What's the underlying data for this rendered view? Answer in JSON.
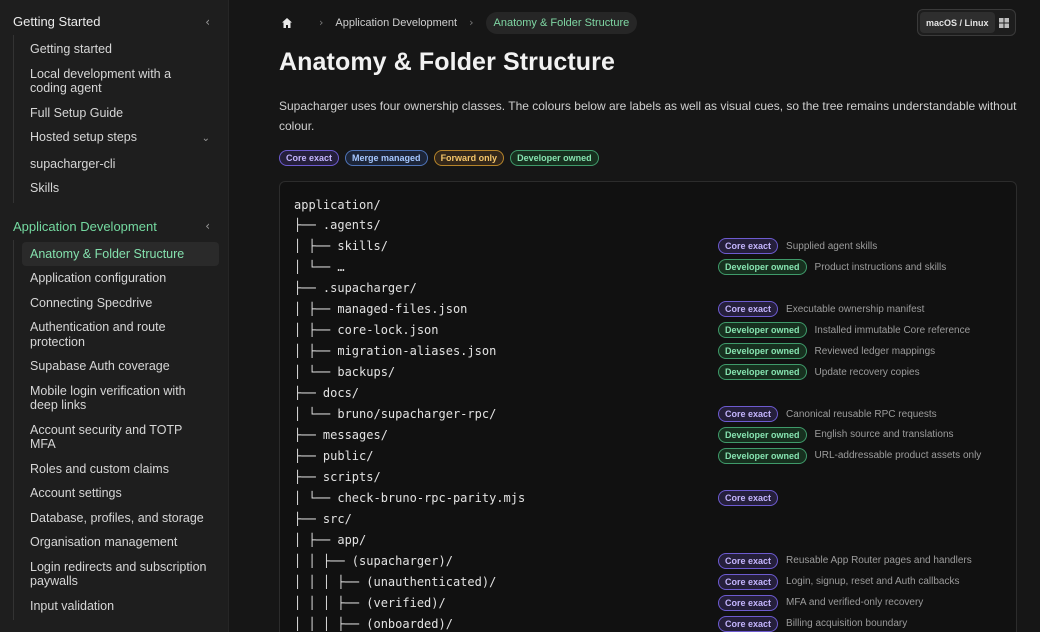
{
  "sidebar": {
    "sections": [
      {
        "title": "Getting Started",
        "active": false,
        "items": [
          {
            "label": "Getting started"
          },
          {
            "label": "Local development with a coding agent"
          },
          {
            "label": "Full Setup Guide"
          },
          {
            "label": "Hosted setup steps",
            "expandable": true
          },
          {
            "label": "supacharger-cli"
          },
          {
            "label": "Skills"
          }
        ]
      },
      {
        "title": "Application Development",
        "active": true,
        "items": [
          {
            "label": "Anatomy & Folder Structure",
            "current": true
          },
          {
            "label": "Application configuration"
          },
          {
            "label": "Connecting Specdrive"
          },
          {
            "label": "Authentication and route protection"
          },
          {
            "label": "Supabase Auth coverage"
          },
          {
            "label": "Mobile login verification with deep links"
          },
          {
            "label": "Account security and TOTP MFA"
          },
          {
            "label": "Roles and custom claims"
          },
          {
            "label": "Account settings"
          },
          {
            "label": "Database, profiles, and storage"
          },
          {
            "label": "Organisation management"
          },
          {
            "label": "Login redirects and subscription paywalls"
          },
          {
            "label": "Input validation"
          }
        ]
      }
    ]
  },
  "breadcrumb": {
    "home_icon": "home-icon",
    "items": [
      "Application Development"
    ],
    "current": "Anatomy & Folder Structure"
  },
  "os_switch": {
    "selected": "macOS / Linux",
    "other_icon": "windows-icon"
  },
  "page": {
    "title": "Anatomy & Folder Structure",
    "intro": "Supacharger uses four ownership classes. The colours below are labels as well as visual cues, so the tree remains understandable without colour."
  },
  "legend": [
    {
      "label": "Core exact",
      "kind": "core"
    },
    {
      "label": "Merge managed",
      "kind": "merge"
    },
    {
      "label": "Forward only",
      "kind": "fwd"
    },
    {
      "label": "Developer owned",
      "kind": "dev"
    }
  ],
  "colors": {
    "accent_green": "#74d9a0",
    "core": "#c4b5fd",
    "merge": "#a6c8ff",
    "forward": "#f5c66a",
    "developer": "#86e3b0"
  },
  "tree": [
    {
      "code": "application/",
      "badge": "",
      "kind": "",
      "desc": ""
    },
    {
      "code": "├── .agents/",
      "badge": "",
      "kind": "",
      "desc": ""
    },
    {
      "code": "│ ├── skills/",
      "badge": "Core exact",
      "kind": "core",
      "desc": "Supplied agent skills"
    },
    {
      "code": "│ └── …",
      "badge": "Developer owned",
      "kind": "dev",
      "desc": "Product instructions and skills"
    },
    {
      "code": "├── .supacharger/",
      "badge": "",
      "kind": "",
      "desc": ""
    },
    {
      "code": "│ ├── managed-files.json",
      "badge": "Core exact",
      "kind": "core",
      "desc": "Executable ownership manifest"
    },
    {
      "code": "│ ├── core-lock.json",
      "badge": "Developer owned",
      "kind": "dev",
      "desc": "Installed immutable Core reference"
    },
    {
      "code": "│ ├── migration-aliases.json",
      "badge": "Developer owned",
      "kind": "dev",
      "desc": "Reviewed ledger mappings"
    },
    {
      "code": "│ └── backups/",
      "badge": "Developer owned",
      "kind": "dev",
      "desc": "Update recovery copies"
    },
    {
      "code": "├── docs/",
      "badge": "",
      "kind": "",
      "desc": ""
    },
    {
      "code": "│ └── bruno/supacharger-rpc/",
      "badge": "Core exact",
      "kind": "core",
      "desc": "Canonical reusable RPC requests"
    },
    {
      "code": "├── messages/",
      "badge": "Developer owned",
      "kind": "dev",
      "desc": "English source and translations"
    },
    {
      "code": "├── public/",
      "badge": "Developer owned",
      "kind": "dev",
      "desc": "URL-addressable product assets only"
    },
    {
      "code": "├── scripts/",
      "badge": "",
      "kind": "",
      "desc": ""
    },
    {
      "code": "│ └── check-bruno-rpc-parity.mjs",
      "badge": "Core exact",
      "kind": "core",
      "desc": ""
    },
    {
      "code": "├── src/",
      "badge": "",
      "kind": "",
      "desc": ""
    },
    {
      "code": "│ ├── app/",
      "badge": "",
      "kind": "",
      "desc": ""
    },
    {
      "code": "│ │ ├── (supacharger)/",
      "badge": "Core exact",
      "kind": "core",
      "desc": "Reusable App Router pages and handlers"
    },
    {
      "code": "│ │ │ ├── (unauthenticated)/",
      "badge": "Core exact",
      "kind": "core",
      "desc": "Login, signup, reset and Auth callbacks"
    },
    {
      "code": "│ │ │ ├── (verified)/",
      "badge": "Core exact",
      "kind": "core",
      "desc": "MFA and verified-only recovery"
    },
    {
      "code": "│ │ │ ├── (onboarded)/",
      "badge": "Core exact",
      "kind": "core",
      "desc": "Billing acquisition boundary"
    }
  ]
}
